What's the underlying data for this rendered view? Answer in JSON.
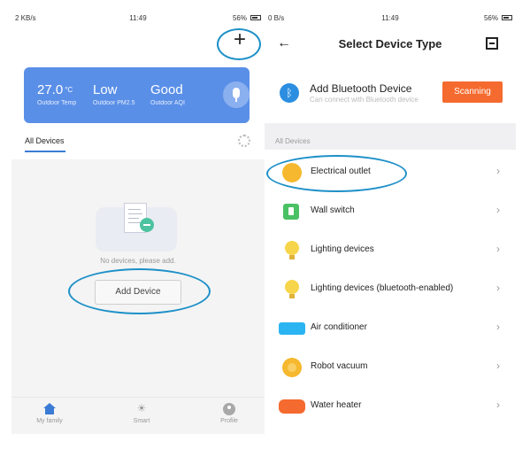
{
  "left": {
    "status": {
      "left": "2 KB/s",
      "time": "11:49",
      "battery": "56%"
    },
    "add_icon": "plus-icon",
    "weather": {
      "items": [
        {
          "value": "27.0",
          "unit": "°C",
          "label": "Outdoor Temp"
        },
        {
          "value": "Low",
          "unit": "",
          "label": "Outdoor PM2.5"
        },
        {
          "value": "Good",
          "unit": "",
          "label": "Outdoor AQI"
        }
      ],
      "mic_icon": "microphone-icon"
    },
    "tab": "All Devices",
    "settings_icon": "gear-icon",
    "empty_text": "No devices, please add.",
    "add_button": "Add Device",
    "nav": [
      {
        "label": "My family",
        "icon": "home-icon"
      },
      {
        "label": "Smart",
        "icon": "sun-icon"
      },
      {
        "label": "Profile",
        "icon": "profile-icon"
      }
    ]
  },
  "right": {
    "status": {
      "left": "0 B/s",
      "time": "11:49",
      "battery": "56%"
    },
    "title": "Select Device Type",
    "back_icon": "back-arrow-icon",
    "scan_icon": "scan-icon",
    "bluetooth": {
      "title": "Add Bluetooth Device",
      "subtitle": "Can connect with Bluetooth device",
      "button": "Scanning"
    },
    "section": "All Devices",
    "devices": [
      {
        "label": "Electrical outlet",
        "icon": "outlet-icon"
      },
      {
        "label": "Wall switch",
        "icon": "switch-icon"
      },
      {
        "label": "Lighting devices",
        "icon": "bulb-icon"
      },
      {
        "label": "Lighting devices (bluetooth-enabled)",
        "icon": "bulb-icon"
      },
      {
        "label": "Air conditioner",
        "icon": "ac-icon"
      },
      {
        "label": "Robot vacuum",
        "icon": "vacuum-icon"
      },
      {
        "label": "Water heater",
        "icon": "water-heater-icon"
      }
    ]
  },
  "colors": {
    "accent": "#3a7bd5",
    "weather_card": "#5a8fe8",
    "scanning": "#f56a2e",
    "highlight": "#1e90c8"
  }
}
